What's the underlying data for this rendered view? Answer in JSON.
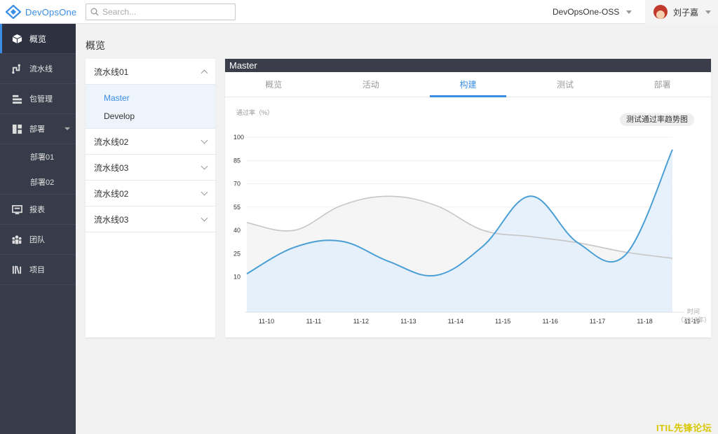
{
  "app": {
    "name": "DevOpsOne"
  },
  "search": {
    "placeholder": "Search..."
  },
  "org": {
    "name": "DevOpsOne-OSS"
  },
  "user": {
    "name": "刘子嘉"
  },
  "sidebar": {
    "items": [
      {
        "label": "概览",
        "icon": "cube-icon",
        "active": true
      },
      {
        "label": "流水线",
        "icon": "pipeline-icon"
      },
      {
        "label": "包管理",
        "icon": "package-icon"
      },
      {
        "label": "部署",
        "icon": "deploy-icon",
        "expanded": true,
        "children": [
          "部署01",
          "部署02"
        ]
      },
      {
        "label": "报表",
        "icon": "report-icon"
      },
      {
        "label": "团队",
        "icon": "team-icon"
      },
      {
        "label": "项目",
        "icon": "project-icon"
      }
    ]
  },
  "page": {
    "title": "概览"
  },
  "pipelines": [
    {
      "name": "流水线01",
      "expanded": true,
      "branches": [
        {
          "name": "Master",
          "active": true
        },
        {
          "name": "Develop"
        }
      ]
    },
    {
      "name": "流水线02"
    },
    {
      "name": "流水线03"
    },
    {
      "name": "流水线02"
    },
    {
      "name": "流水线03"
    }
  ],
  "panel": {
    "title": "Master",
    "tabs": [
      {
        "label": "概览"
      },
      {
        "label": "活动"
      },
      {
        "label": "构建",
        "active": true
      },
      {
        "label": "测试"
      },
      {
        "label": "部署"
      }
    ],
    "legend_button": "测试通过率趋势图"
  },
  "chart_data": {
    "type": "area",
    "ylabel": "通过率（%）",
    "xlabel": "时间",
    "x_unit": "（2017年）",
    "categories": [
      "11-10",
      "11-11",
      "11-12",
      "11-13",
      "11-14",
      "11-15",
      "11-16",
      "11-17",
      "11-18",
      "11-19"
    ],
    "yticks": [
      10,
      25,
      40,
      55,
      70,
      85,
      100
    ],
    "series": [
      {
        "values": [
          12,
          29,
          33,
          20,
          11,
          30,
          62,
          32,
          24,
          92
        ],
        "color": "#4a9fd5",
        "fill": "#e3eefb"
      },
      {
        "values": [
          45,
          40,
          56,
          62,
          56,
          40,
          36,
          32,
          26,
          22
        ],
        "color": "#c6c6c6",
        "fill": "#f4f4f4"
      }
    ]
  },
  "watermark": "ITIL先锋论坛",
  "colors": {
    "accent": "#3a8ee6",
    "sidebar": "#373c4a",
    "panel_title": "#3b3e4a"
  }
}
